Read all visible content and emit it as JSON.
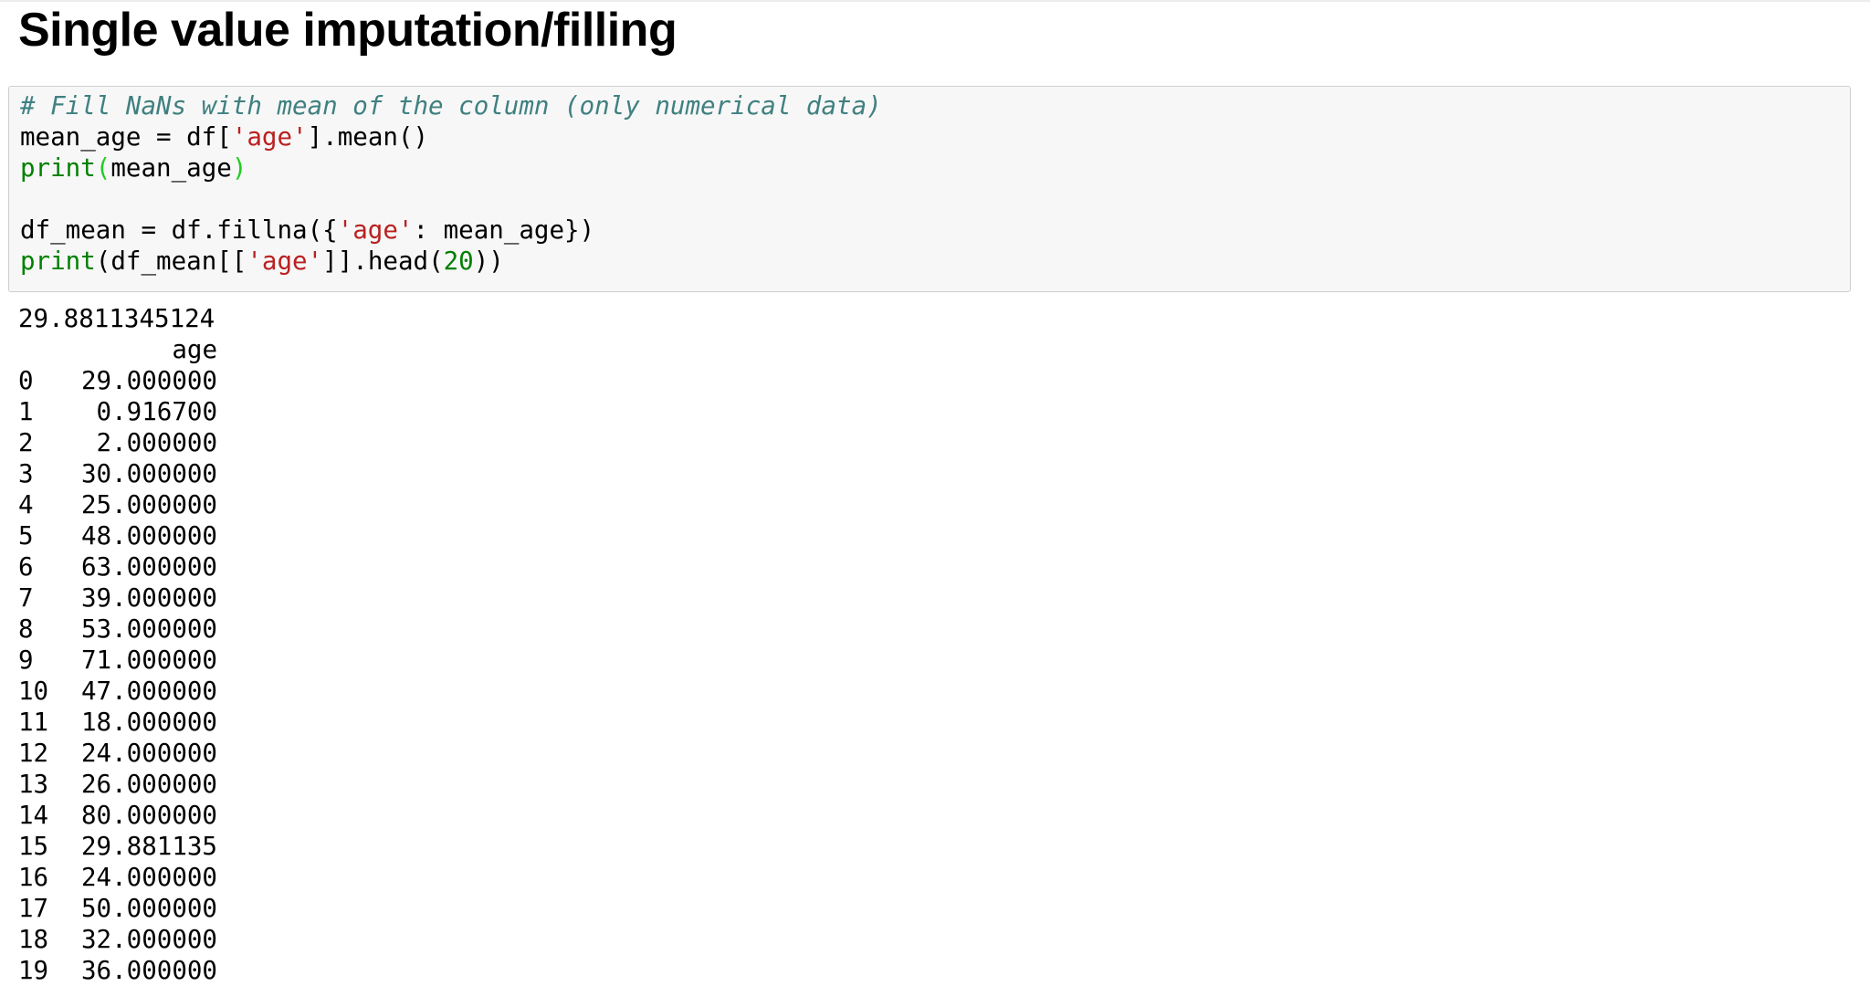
{
  "heading": "Single value imputation/filling",
  "code_cell": {
    "lines": [
      [
        {
          "t": "# Fill NaNs with mean of the column (only numerical data)",
          "c": "comment"
        }
      ],
      [
        {
          "t": "mean_age = df[",
          "c": "plain"
        },
        {
          "t": "'age'",
          "c": "string"
        },
        {
          "t": "].mean()",
          "c": "plain"
        }
      ],
      [
        {
          "t": "print",
          "c": "builtin"
        },
        {
          "t": "(",
          "c": "paren-hl"
        },
        {
          "t": "mean_age",
          "c": "plain"
        },
        {
          "t": ")",
          "c": "paren-hl"
        }
      ],
      [],
      [
        {
          "t": "df_mean = df.fillna({",
          "c": "plain"
        },
        {
          "t": "'age'",
          "c": "string"
        },
        {
          "t": ": mean_age})",
          "c": "plain"
        }
      ],
      [
        {
          "t": "print",
          "c": "builtin"
        },
        {
          "t": "(df_mean[[",
          "c": "plain"
        },
        {
          "t": "'age'",
          "c": "string"
        },
        {
          "t": "]].head(",
          "c": "plain"
        },
        {
          "t": "20",
          "c": "number"
        },
        {
          "t": "))",
          "c": "plain"
        }
      ]
    ]
  },
  "output": {
    "printed_mean": "29.8811345124",
    "column_header": "age",
    "rows": [
      {
        "index": "0",
        "value": "29.000000"
      },
      {
        "index": "1",
        "value": "0.916700"
      },
      {
        "index": "2",
        "value": "2.000000"
      },
      {
        "index": "3",
        "value": "30.000000"
      },
      {
        "index": "4",
        "value": "25.000000"
      },
      {
        "index": "5",
        "value": "48.000000"
      },
      {
        "index": "6",
        "value": "63.000000"
      },
      {
        "index": "7",
        "value": "39.000000"
      },
      {
        "index": "8",
        "value": "53.000000"
      },
      {
        "index": "9",
        "value": "71.000000"
      },
      {
        "index": "10",
        "value": "47.000000"
      },
      {
        "index": "11",
        "value": "18.000000"
      },
      {
        "index": "12",
        "value": "24.000000"
      },
      {
        "index": "13",
        "value": "26.000000"
      },
      {
        "index": "14",
        "value": "80.000000"
      },
      {
        "index": "15",
        "value": "29.881135"
      },
      {
        "index": "16",
        "value": "24.000000"
      },
      {
        "index": "17",
        "value": "50.000000"
      },
      {
        "index": "18",
        "value": "32.000000"
      },
      {
        "index": "19",
        "value": "36.000000"
      }
    ]
  },
  "colors": {
    "comment": "#408080",
    "string": "#ba2121",
    "builtin": "#008000",
    "matched_paren": "#22cc22",
    "cell_background": "#f7f7f7",
    "cell_border": "#cfcfcf"
  }
}
